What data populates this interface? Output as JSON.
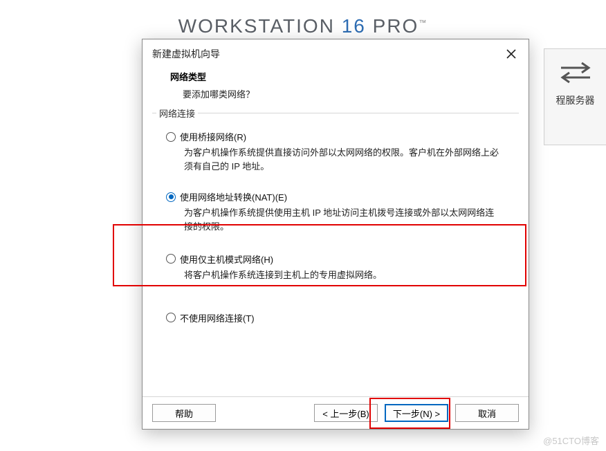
{
  "brand": {
    "name": "WORKSTATION",
    "version": "16",
    "edition": "PRO",
    "tm": "™"
  },
  "bg_panel": {
    "label": "程服务器"
  },
  "dialog": {
    "title": "新建虚拟机向导",
    "heading": "网络类型",
    "subheading": "要添加哪类网络？",
    "group_title": "网络连接",
    "options": {
      "bridged": {
        "label": "使用桥接网络(R)",
        "desc": "为客户机操作系统提供直接访问外部以太网网络的权限。客户机在外部网络上必须有自己的 IP 地址。"
      },
      "nat": {
        "label": "使用网络地址转换(NAT)(E)",
        "desc": "为客户机操作系统提供使用主机 IP 地址访问主机拨号连接或外部以太网网络连接的权限。"
      },
      "hostonly": {
        "label": "使用仅主机模式网络(H)",
        "desc": "将客户机操作系统连接到主机上的专用虚拟网络。"
      },
      "none": {
        "label": "不使用网络连接(T)"
      }
    },
    "buttons": {
      "help": "帮助",
      "back": "< 上一步(B)",
      "next": "下一步(N) >",
      "cancel": "取消"
    }
  },
  "watermark": "@51CTO博客"
}
